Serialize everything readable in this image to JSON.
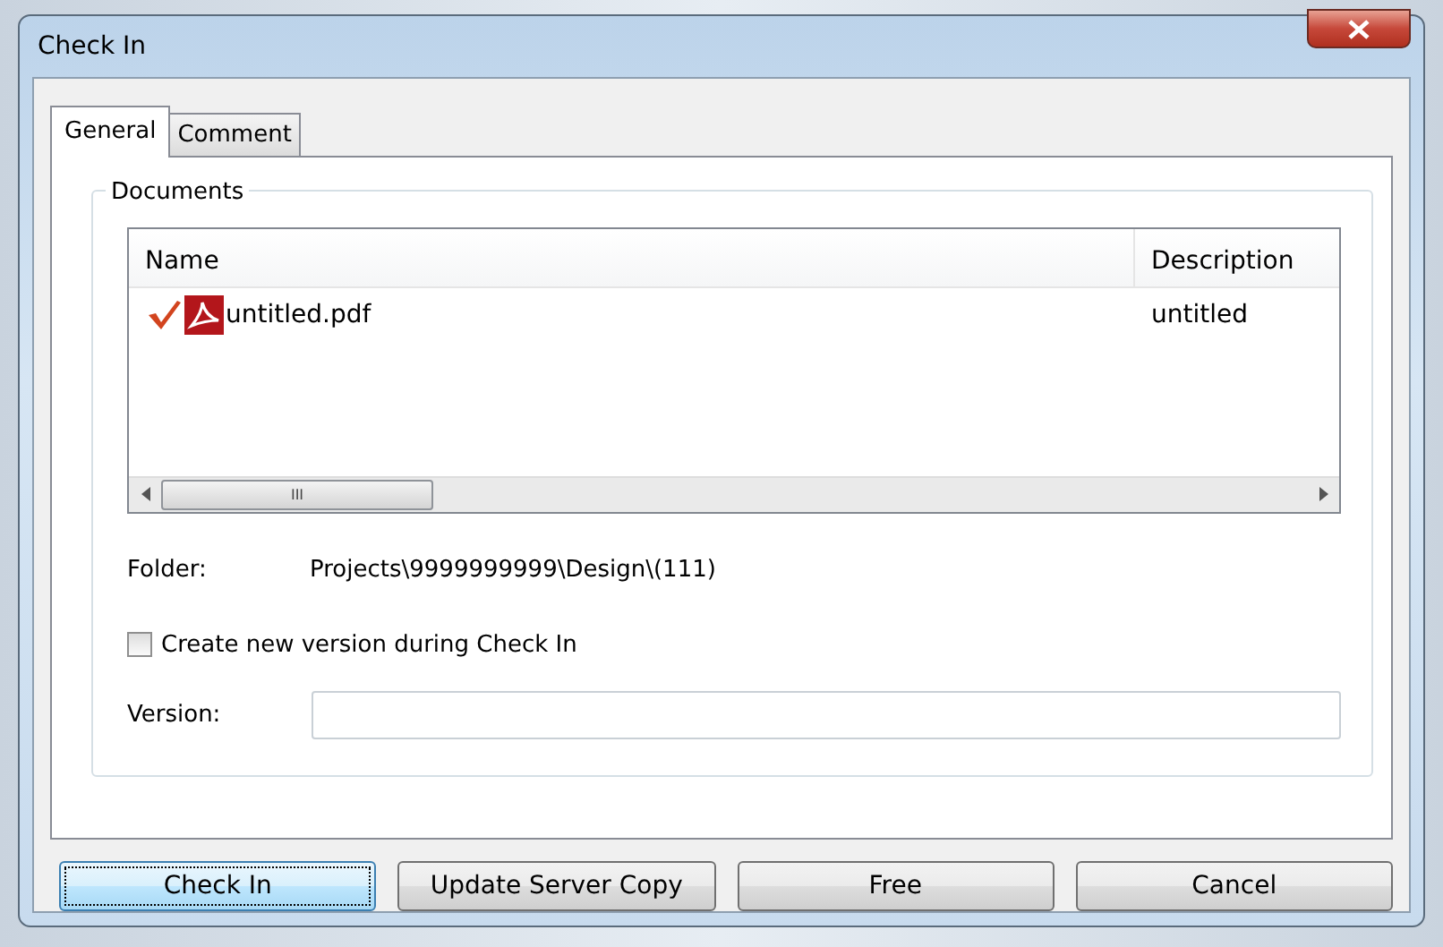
{
  "window": {
    "title": "Check In"
  },
  "tabs": [
    {
      "label": "General",
      "selected": true
    },
    {
      "label": "Comment",
      "selected": false
    }
  ],
  "documents": {
    "group_label": "Documents",
    "columns": [
      "Name",
      "Description"
    ],
    "rows": [
      {
        "checked": true,
        "name": "untitled.pdf",
        "description": "untitled"
      }
    ],
    "scrollbar_grip": "III"
  },
  "folder": {
    "label": "Folder:",
    "value": "Projects\\9999999999\\Design\\(111)"
  },
  "create_new_version": {
    "label": "Create new version during Check In",
    "checked": false
  },
  "version": {
    "label": "Version:"
  },
  "buttons": [
    {
      "label": "Check In",
      "focused": true
    },
    {
      "label": "Update Server Copy",
      "focused": false
    },
    {
      "label": "Free",
      "focused": false
    },
    {
      "label": "Cancel",
      "focused": false
    }
  ]
}
